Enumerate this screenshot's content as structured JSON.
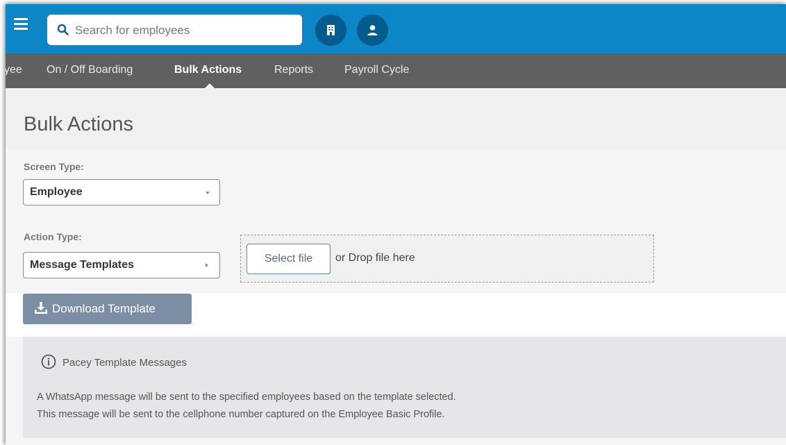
{
  "topbar": {
    "search_placeholder": "Search for employees"
  },
  "nav": {
    "items": [
      {
        "label": "yee"
      },
      {
        "label": "On / Off Boarding"
      },
      {
        "label": "Bulk Actions",
        "active": true
      },
      {
        "label": "Reports"
      },
      {
        "label": "Payroll Cycle"
      }
    ]
  },
  "page": {
    "title": "Bulk Actions"
  },
  "form": {
    "screen_type_label": "Screen Type:",
    "screen_type_value": "Employee",
    "action_type_label": "Action Type:",
    "action_type_value": "Message Templates",
    "select_file_label": "Select file",
    "drop_text": "or Drop file here",
    "download_label": "Download Template"
  },
  "info": {
    "title": "Pacey Template Messages",
    "line1": "A WhatsApp message will be sent to the specified employees based on the template selected.",
    "line2": "This message will be sent to the cellphone number captured on the Employee Basic Profile."
  },
  "colors": {
    "topbar": "#0c86c6",
    "navbar": "#606060",
    "button": "#7c8ea3"
  },
  "icons": [
    "menu-icon",
    "search-icon",
    "building-icon",
    "user-icon",
    "download-icon",
    "info-icon",
    "chevron-down-icon",
    "chevron-right-icon"
  ]
}
